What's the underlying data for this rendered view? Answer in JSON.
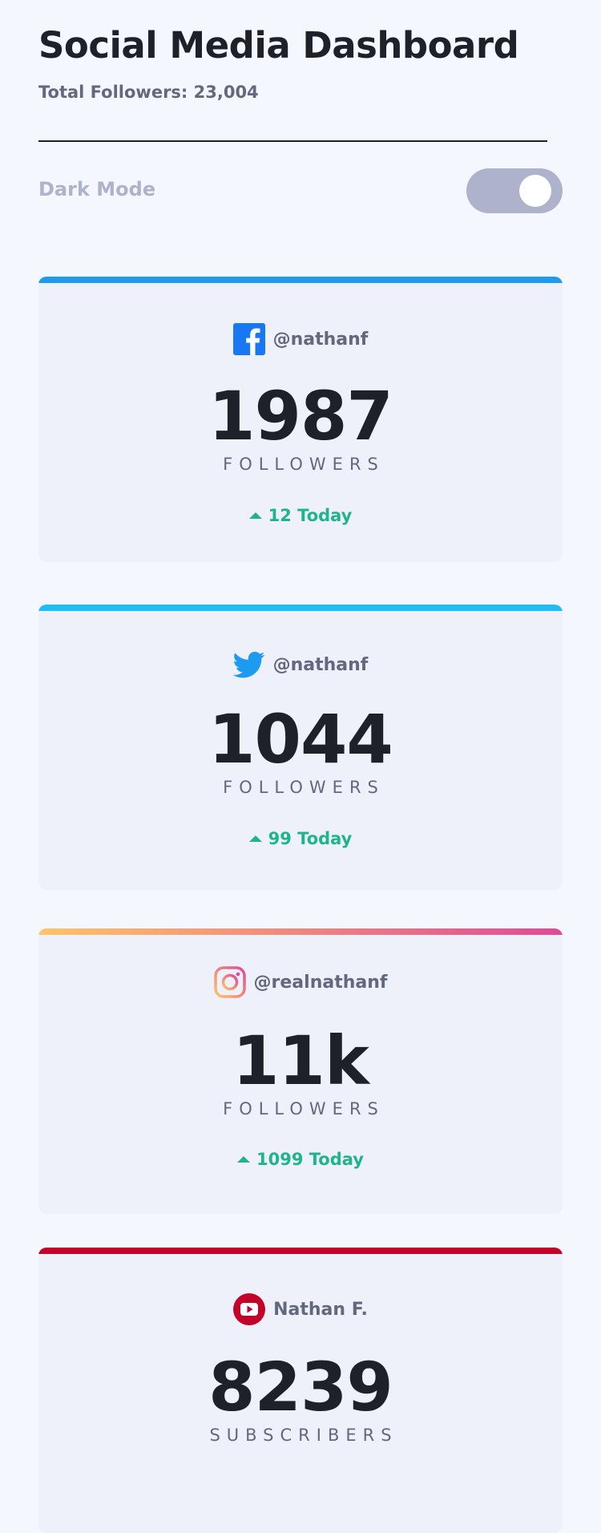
{
  "header": {
    "title": "Social Media Dashboard",
    "total_followers": "Total Followers: 23,004"
  },
  "theme_toggle": {
    "label": "Dark Mode",
    "state": "off"
  },
  "colors": {
    "background": "#f5f7ff",
    "card_background": "#eef1fa",
    "positive": "#1eb589",
    "facebook": "#1d9bf0",
    "twitter": "#1ebdf5",
    "instagram_gradient": [
      "#fdc468",
      "#df4996"
    ],
    "youtube": "#c4032a"
  },
  "cards": [
    {
      "platform_icon": "facebook-icon",
      "handle": "@nathanf",
      "count": "1987",
      "label": "FOLLOWERS",
      "today": "12 Today",
      "today_direction": "up"
    },
    {
      "platform_icon": "twitter-icon",
      "handle": "@nathanf",
      "count": "1044",
      "label": "FOLLOWERS",
      "today": "99 Today",
      "today_direction": "up"
    },
    {
      "platform_icon": "instagram-icon",
      "handle": "@realnathanf",
      "count": "11k",
      "label": "FOLLOWERS",
      "today": "1099 Today",
      "today_direction": "up"
    },
    {
      "platform_icon": "youtube-icon",
      "handle": "Nathan F.",
      "count": "8239",
      "label": "SUBSCRIBERS"
    }
  ]
}
